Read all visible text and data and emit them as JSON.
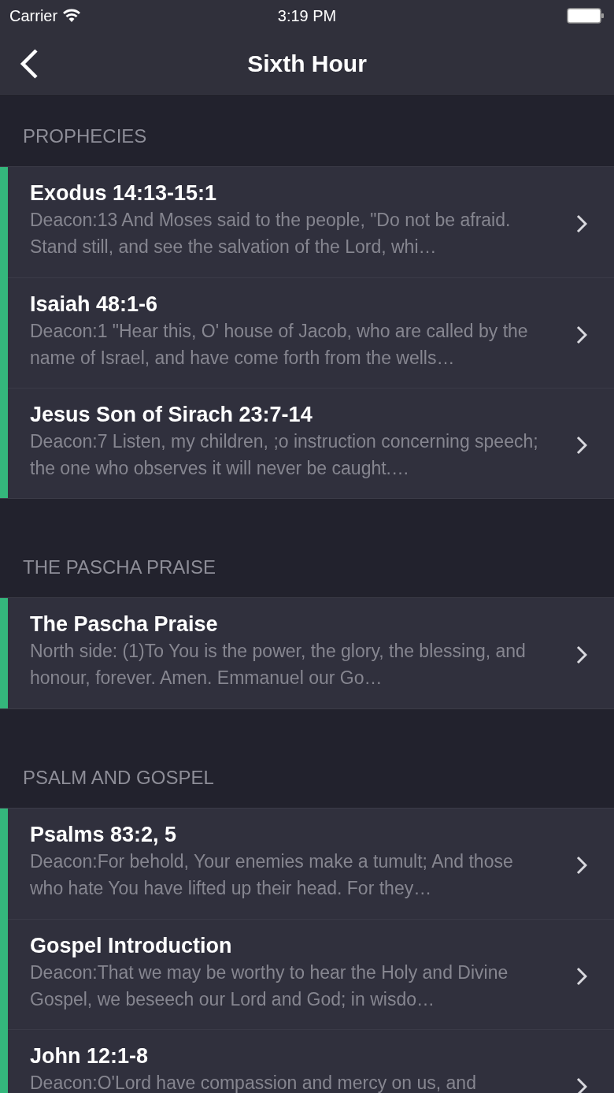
{
  "status_bar": {
    "carrier": "Carrier",
    "time": "3:19 PM"
  },
  "nav": {
    "title": "Sixth Hour"
  },
  "sections": [
    {
      "header": "PROPHECIES",
      "items": [
        {
          "title": "Exodus 14:13-15:1",
          "snippet": "Deacon:13 And Moses said to the people, \"Do not be afraid. Stand still, and see the salvation of the Lord, whi…"
        },
        {
          "title": "Isaiah 48:1-6",
          "snippet": "Deacon:1 \"Hear this, O' house of Jacob, who are called by the name of Israel, and have come forth from the wells…"
        },
        {
          "title": "Jesus Son of Sirach 23:7-14",
          "snippet": "Deacon:7 Listen, my children, ;o instruction concerning speech; the one who observes it will never be caught.…"
        }
      ]
    },
    {
      "header": "THE PASCHA PRAISE",
      "items": [
        {
          "title": "The Pascha Praise",
          "snippet": "North side: (1)To You is the power, the glory, the blessing, and honour, forever. Amen. Emmanuel our Go…"
        }
      ]
    },
    {
      "header": "PSALM AND GOSPEL",
      "items": [
        {
          "title": "Psalms 83:2, 5",
          "snippet": "Deacon:For behold, Your enemies make a tumult; And those who hate You have lifted up their head. For they…"
        },
        {
          "title": "Gospel Introduction",
          "snippet": "Deacon:That we may be worthy to hear the Holy and Divine Gospel, we beseech our Lord and God; in wisdo…"
        },
        {
          "title": "John 12:1-8",
          "snippet": "Deacon:O'Lord have compassion and mercy on us, and"
        }
      ]
    }
  ]
}
